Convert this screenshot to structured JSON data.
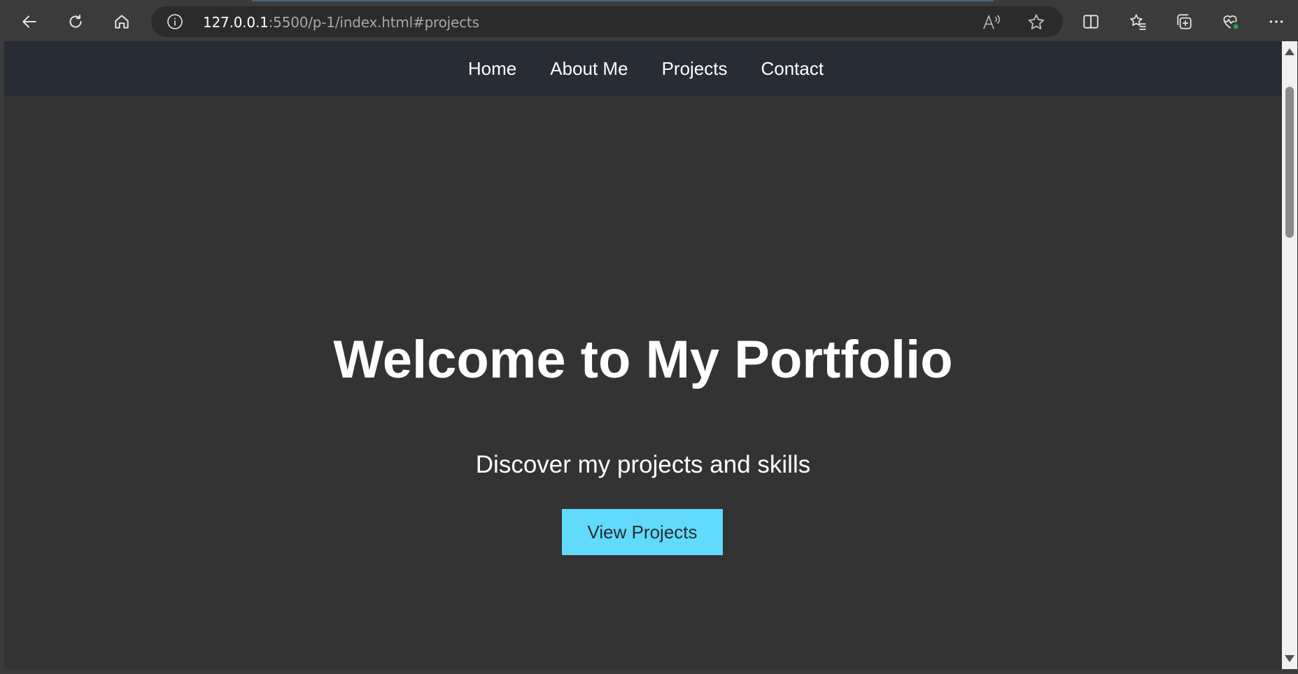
{
  "browser": {
    "url_host": "127.0.0.1",
    "url_rest": ":5500/p-1/index.html#projects",
    "icons": [
      "back-icon",
      "refresh-icon",
      "home-icon",
      "site-info-icon",
      "read-aloud-icon",
      "favorite-star-icon",
      "split-screen-icon",
      "favorites-icon",
      "collections-icon",
      "browser-essentials-icon",
      "more-icon"
    ]
  },
  "nav": {
    "items": [
      {
        "label": "Home"
      },
      {
        "label": "About Me"
      },
      {
        "label": "Projects"
      },
      {
        "label": "Contact"
      }
    ]
  },
  "hero": {
    "title": "Welcome to My Portfolio",
    "subtitle": "Discover my projects and skills",
    "cta_label": "View Projects"
  },
  "colors": {
    "nav_bg": "#282c34",
    "page_bg": "#333333",
    "accent": "#61dafb",
    "text": "#ffffff"
  }
}
